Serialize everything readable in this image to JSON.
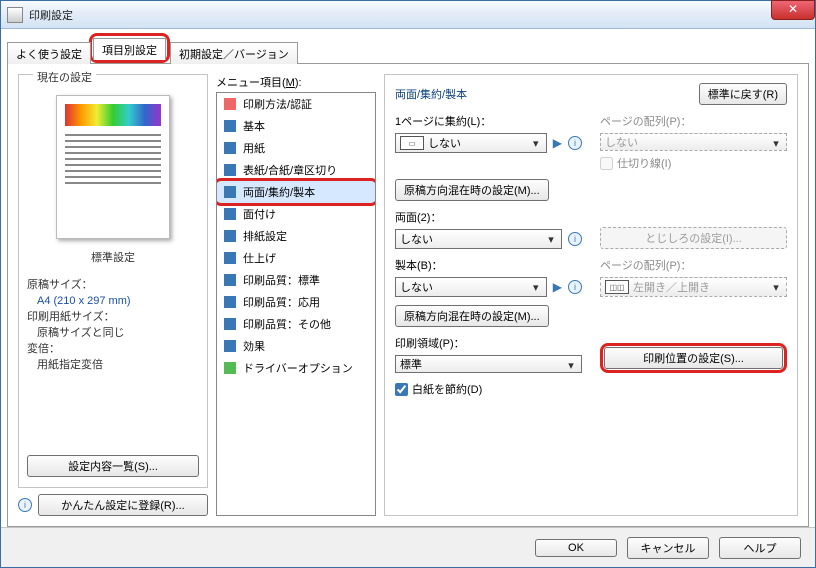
{
  "window": {
    "title": "印刷設定",
    "close": "✕"
  },
  "tabs": {
    "t0": "よく使う設定",
    "t1": "項目別設定",
    "t2": "初期設定／バージョン"
  },
  "left": {
    "groupTitle": "現在の設定",
    "presetName": "標準設定",
    "specLabels": {
      "orig": "原稿サイズ：",
      "paper": "印刷用紙サイズ：",
      "zoom": "変倍："
    },
    "specValues": {
      "orig": "A4 (210 x 297 mm)",
      "paper": "原稿サイズと同じ",
      "zoom": "用紙指定変倍"
    },
    "listBtn": "設定内容一覧(S)...",
    "registerBtn": "かんたん設定に登録(R)..."
  },
  "mid": {
    "label": "メニュー項目(",
    "labelU": "M",
    "labelEnd": "):",
    "items": [
      "印刷方法/認証",
      "基本",
      "用紙",
      "表紙/合紙/章区切り",
      "両面/集約/製本",
      "面付け",
      "排紙設定",
      "仕上げ",
      "印刷品質：標準",
      "印刷品質：応用",
      "印刷品質：その他",
      "効果",
      "ドライバーオプション"
    ],
    "selectedIndex": 4
  },
  "right": {
    "sectionTitle": "両面/集約/製本",
    "restoreBtn": "標準に戻す(R)",
    "aggregate": {
      "label": "1ページに集約(L)：",
      "value": "しない",
      "layoutLabel": "ページの配列(P)：",
      "layoutValue": "しない",
      "sepLabel": "仕切り線(I)"
    },
    "mixBtn1": "原稿方向混在時の設定(M)...",
    "duplex": {
      "label": "両面(2)：",
      "value": "しない",
      "bindingBtn": "とじしろの設定(I)..."
    },
    "booklet": {
      "label": "製本(B)：",
      "value": "しない",
      "layoutLabel": "ページの配列(P)：",
      "layoutValue": "左開き／上開き"
    },
    "mixBtn2": "原稿方向混在時の設定(M)...",
    "printArea": {
      "label": "印刷領域(P)：",
      "value": "標準",
      "posBtn": "印刷位置の設定(S)..."
    },
    "blank": {
      "label": "白紙を節約(D)"
    }
  },
  "footer": {
    "ok": "OK",
    "cancel": "キャンセル",
    "help": "ヘルプ"
  }
}
